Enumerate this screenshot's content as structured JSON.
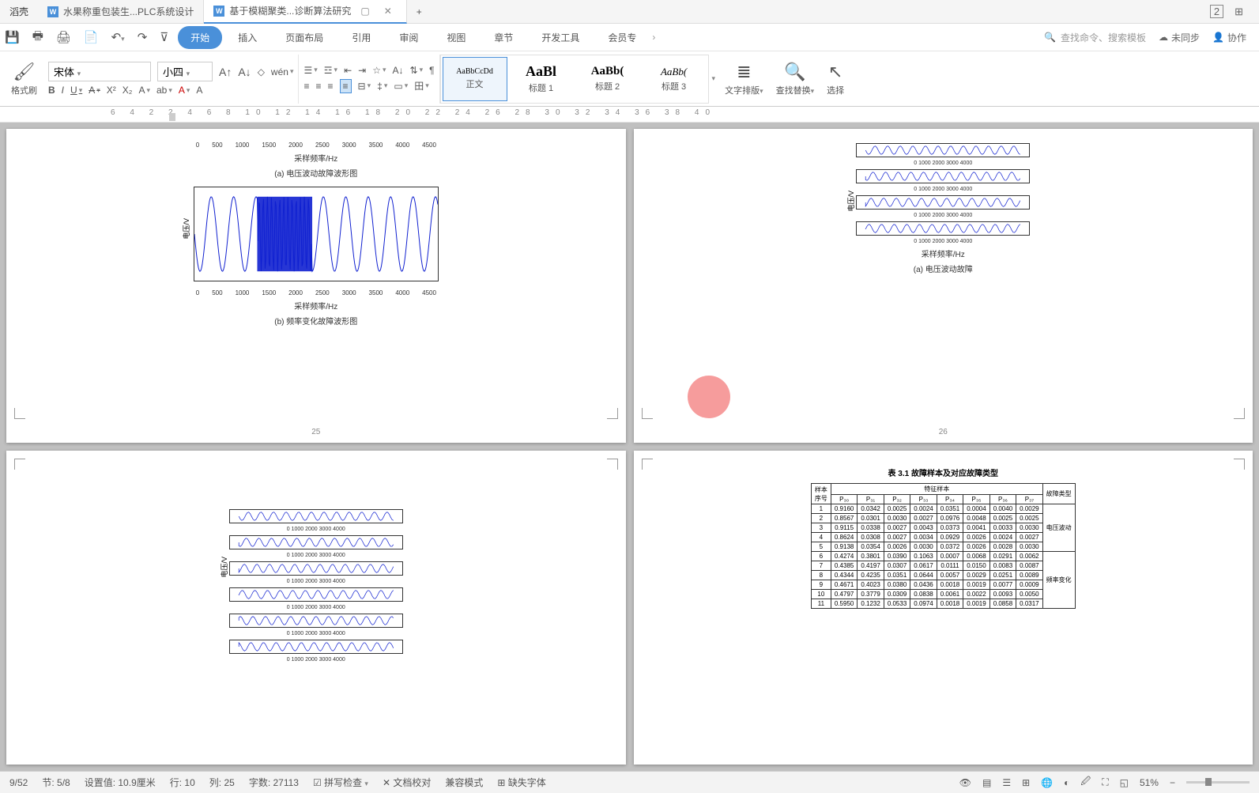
{
  "title_bar": {
    "left_label": "滔壳",
    "tabs": [
      {
        "label": "水果称重包装生...PLC系统设计",
        "active": false
      },
      {
        "label": "基于模糊聚类...诊断算法研究",
        "active": true
      }
    ],
    "add_tab": "+",
    "window_num": "2"
  },
  "ribbon": {
    "tabs": [
      "开始",
      "插入",
      "页面布局",
      "引用",
      "审阅",
      "视图",
      "章节",
      "开发工具",
      "会员专"
    ],
    "active_tab": "开始",
    "search_placeholder": "查找命令、搜索模板",
    "not_synced": "未同步",
    "collab": "协作"
  },
  "toolbar": {
    "format_painter": "格式刷",
    "font_name": "宋体",
    "font_size": "小四",
    "styles": [
      {
        "preview": "AaBbCcDd",
        "name": "正文",
        "cls": "font-size:10px",
        "sel": true
      },
      {
        "preview": "AaBl",
        "name": "标题 1",
        "cls": "font-size:18px;font-weight:bold",
        "sel": false
      },
      {
        "preview": "AaBb(",
        "name": "标题 2",
        "cls": "font-size:15px;font-weight:bold",
        "sel": false
      },
      {
        "preview": "AaBb(",
        "name": "标题 3",
        "cls": "font-size:13px;font-style:italic",
        "sel": false
      }
    ],
    "text_layout": "文字排版",
    "find_replace": "查找替换",
    "select": "选择"
  },
  "ruler_numbers": "6  4  2     2  4  6  8  10  12  14  16  18  20  22  24  26  28  30  32  34  36  38  40",
  "doc": {
    "page25": {
      "num": "25",
      "chart_a": {
        "x_ticks": [
          "0",
          "500",
          "1000",
          "1500",
          "2000",
          "2500",
          "3000",
          "3500",
          "4000",
          "4500"
        ],
        "xlabel": "采样频率/Hz",
        "caption": "(a) 电压波动故障波形图"
      },
      "chart_b": {
        "x_ticks": [
          "0",
          "500",
          "1000",
          "1500",
          "2000",
          "2500",
          "3000",
          "3500",
          "4000",
          "4500"
        ],
        "xlabel": "采样频率/Hz",
        "caption": "(b) 频率变化故障波形图",
        "ylabel": "电压/V"
      }
    },
    "page26": {
      "num": "26",
      "xlabel": "采样频率/Hz",
      "caption": "(a) 电压波动故障",
      "ylabel": "电压/V"
    },
    "page27": {
      "ylabel": "电压/V"
    },
    "page28": {
      "table_title": "表 3.1 故障样本及对应故障类型",
      "header_group": "特征样本",
      "col_left": "样本\n序号",
      "col_right": "故障类型",
      "cols": [
        "P₃₀",
        "P₃₁",
        "P₃₂",
        "P₃₃",
        "P₃₄",
        "P₃₅",
        "P₃₆",
        "P₃₇"
      ],
      "fault1": "电压波动",
      "fault2": "频率变化",
      "rows": [
        [
          "1",
          "0.9160",
          "0.0342",
          "0.0025",
          "0.0024",
          "0.0351",
          "0.0004",
          "0.0040",
          "0.0029"
        ],
        [
          "2",
          "0.8567",
          "0.0301",
          "0.0030",
          "0.0027",
          "0.0976",
          "0.0048",
          "0.0025",
          "0.0025"
        ],
        [
          "3",
          "0.9115",
          "0.0338",
          "0.0027",
          "0.0043",
          "0.0373",
          "0.0041",
          "0.0033",
          "0.0030"
        ],
        [
          "4",
          "0.8624",
          "0.0308",
          "0.0027",
          "0.0034",
          "0.0929",
          "0.0026",
          "0.0024",
          "0.0027"
        ],
        [
          "5",
          "0.9138",
          "0.0354",
          "0.0026",
          "0.0030",
          "0.0372",
          "0.0026",
          "0.0028",
          "0.0030"
        ],
        [
          "6",
          "0.4274",
          "0.3801",
          "0.0390",
          "0.1063",
          "0.0007",
          "0.0068",
          "0.0291",
          "0.0062"
        ],
        [
          "7",
          "0.4385",
          "0.4197",
          "0.0307",
          "0.0617",
          "0.0111",
          "0.0150",
          "0.0083",
          "0.0087"
        ],
        [
          "8",
          "0.4344",
          "0.4235",
          "0.0351",
          "0.0644",
          "0.0057",
          "0.0029",
          "0.0251",
          "0.0089"
        ],
        [
          "9",
          "0.4671",
          "0.4023",
          "0.0380",
          "0.0436",
          "0.0018",
          "0.0019",
          "0.0077",
          "0.0009"
        ],
        [
          "10",
          "0.4797",
          "0.3779",
          "0.0309",
          "0.0838",
          "0.0061",
          "0.0022",
          "0.0093",
          "0.0050"
        ],
        [
          "11",
          "0.5950",
          "0.1232",
          "0.0533",
          "0.0974",
          "0.0018",
          "0.0019",
          "0.0858",
          "0.0317"
        ]
      ]
    }
  },
  "status": {
    "page": "9/52",
    "section": "节: 5/8",
    "pos": "设置值: 10.9厘米",
    "row": "行: 10",
    "col": "列: 25",
    "words": "字数: 27113",
    "spellcheck": "拼写检查",
    "doccheck": "文档校对",
    "compat": "兼容模式",
    "missing_font": "缺失字体",
    "zoom": "51%"
  },
  "chart_data": [
    {
      "type": "line",
      "title": "(a) 电压波动故障波形图",
      "xlabel": "采样频率/Hz",
      "ylabel": "电压/V",
      "x_range": [
        0,
        4500
      ],
      "y_range": [
        -1,
        1
      ],
      "description": "Sinusoidal voltage waveform with amplitude fluctuation fault"
    },
    {
      "type": "line",
      "title": "(b) 频率变化故障波形图",
      "xlabel": "采样频率/Hz",
      "ylabel": "电压/V",
      "x_range": [
        0,
        4500
      ],
      "y_range": [
        -1.5,
        1.5
      ],
      "description": "Sinusoidal voltage waveform with frequency change fault, dense region 1200-2200"
    },
    {
      "type": "table",
      "title": "表 3.1 故障样本及对应故障类型",
      "columns": [
        "样本序号",
        "P30",
        "P31",
        "P32",
        "P33",
        "P34",
        "P35",
        "P36",
        "P37",
        "故障类型"
      ],
      "data": [
        [
          1,
          0.916,
          0.0342,
          0.0025,
          0.0024,
          0.0351,
          0.0004,
          0.004,
          0.0029,
          "电压波动"
        ],
        [
          2,
          0.8567,
          0.0301,
          0.003,
          0.0027,
          0.0976,
          0.0048,
          0.0025,
          0.0025,
          "电压波动"
        ],
        [
          3,
          0.9115,
          0.0338,
          0.0027,
          0.0043,
          0.0373,
          0.0041,
          0.0033,
          0.003,
          "电压波动"
        ],
        [
          4,
          0.8624,
          0.0308,
          0.0027,
          0.0034,
          0.0929,
          0.0026,
          0.0024,
          0.0027,
          "电压波动"
        ],
        [
          5,
          0.9138,
          0.0354,
          0.0026,
          0.003,
          0.0372,
          0.0026,
          0.0028,
          0.003,
          "电压波动"
        ],
        [
          6,
          0.4274,
          0.3801,
          0.039,
          0.1063,
          0.0007,
          0.0068,
          0.0291,
          0.0062,
          "频率变化"
        ],
        [
          7,
          0.4385,
          0.4197,
          0.0307,
          0.0617,
          0.0111,
          0.015,
          0.0083,
          0.0087,
          "频率变化"
        ],
        [
          8,
          0.4344,
          0.4235,
          0.0351,
          0.0644,
          0.0057,
          0.0029,
          0.0251,
          0.0089,
          "频率变化"
        ],
        [
          9,
          0.4671,
          0.4023,
          0.038,
          0.0436,
          0.0018,
          0.0019,
          0.0077,
          0.0009,
          "频率变化"
        ],
        [
          10,
          0.4797,
          0.3779,
          0.0309,
          0.0838,
          0.0061,
          0.0022,
          0.0093,
          0.005,
          "频率变化"
        ],
        [
          11,
          0.595,
          0.1232,
          0.0533,
          0.0974,
          0.0018,
          0.0019,
          0.0858,
          0.0317,
          "频率变化"
        ]
      ]
    }
  ]
}
